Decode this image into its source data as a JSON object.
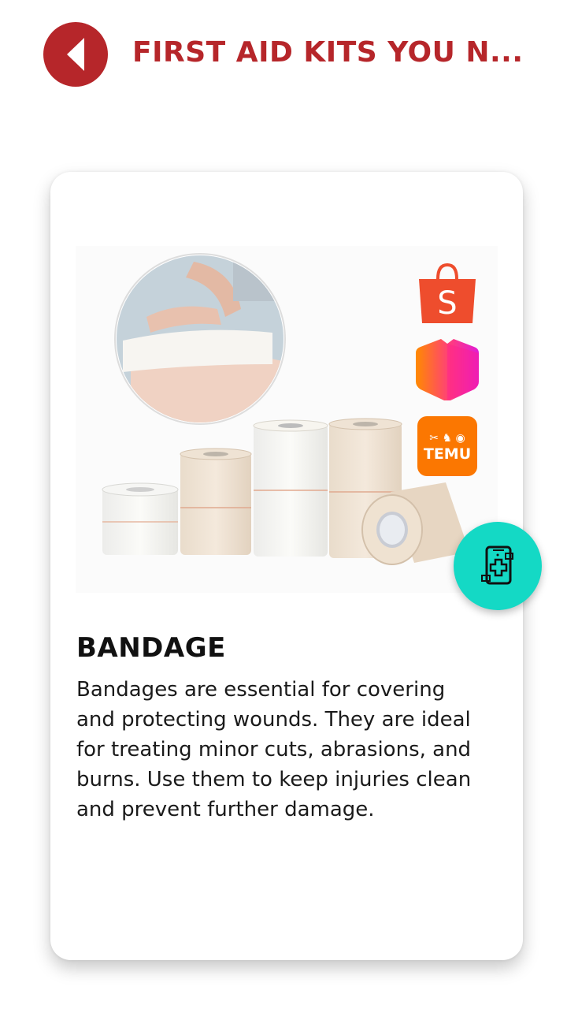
{
  "header": {
    "title": "FIRST AID KITS YOU N...",
    "back_icon": "chevron-left-icon"
  },
  "colors": {
    "brand_red": "#b6262a",
    "fab_teal": "#14d9c5",
    "shopee_orange": "#ee4d2d",
    "temu_orange": "#fb7701"
  },
  "product": {
    "name": "BANDAGE",
    "description": "Bandages are essential for covering and protecting wounds. They are ideal for treating minor cuts, abrasions, and burns. Use them to keep injuries clean and prevent further damage.",
    "shop_links": [
      {
        "icon": "shopee-icon",
        "label": "S"
      },
      {
        "icon": "lazada-icon"
      },
      {
        "icon": "temu-icon",
        "label": "TEMU"
      }
    ]
  },
  "fab": {
    "icon": "phone-medical-icon"
  }
}
